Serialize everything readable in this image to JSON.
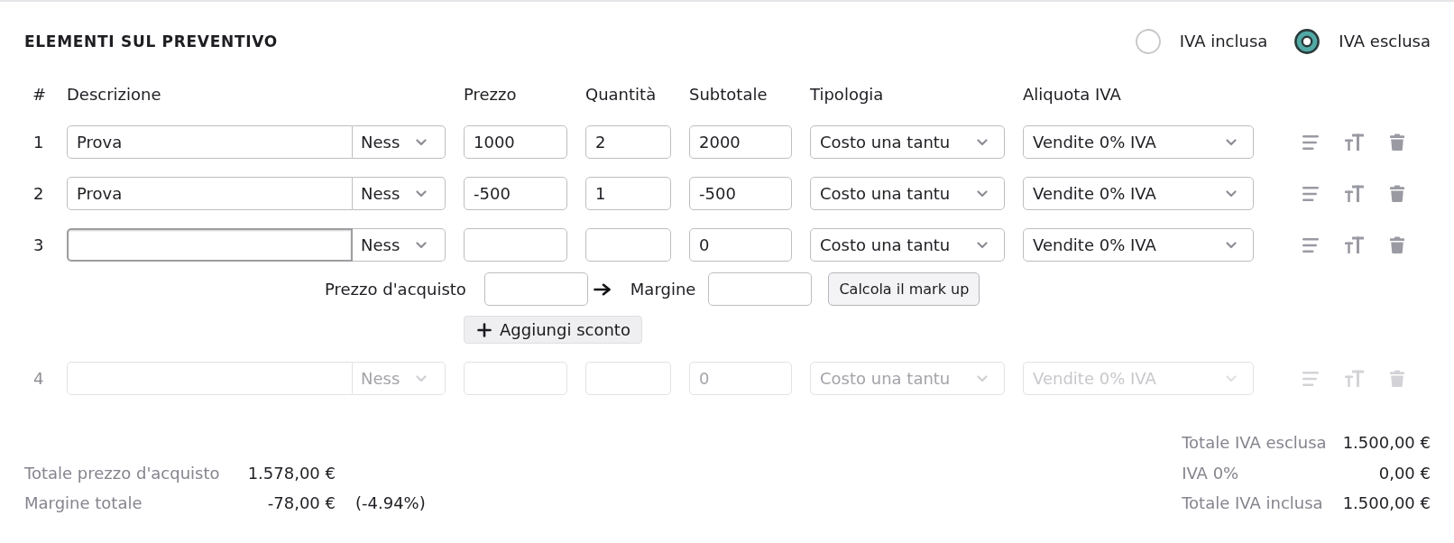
{
  "section": {
    "title": "ELEMENTI SUL PREVENTIVO"
  },
  "vat_mode": [
    {
      "label": "IVA inclusa",
      "selected": false
    },
    {
      "label": "IVA esclusa",
      "selected": true
    }
  ],
  "columns": [
    "#",
    "Descrizione",
    "Prezzo",
    "Quantità",
    "Subtotale",
    "Tipologia",
    "Aliquota IVA"
  ],
  "rows": [
    {
      "number": "1",
      "description": "Prova",
      "unit": "Ness",
      "price": "1000",
      "quantity": "2",
      "subtotal": "2000",
      "type": "Costo una tantu",
      "vat_rate": "Vendite 0% IVA",
      "focused": false,
      "disabled": false
    },
    {
      "number": "2",
      "description": "Prova",
      "unit": "Ness",
      "price": "-500",
      "quantity": "1",
      "subtotal": "-500",
      "type": "Costo una tantu",
      "vat_rate": "Vendite 0% IVA",
      "focused": false,
      "disabled": false
    },
    {
      "number": "3",
      "unit": "Ness",
      "subtotal": "0",
      "type": "Costo una tantu",
      "vat_rate": "Vendite 0% IVA",
      "focused": true,
      "disabled": false,
      "markup": {
        "purchase_price_label": "Prezzo d'acquisto",
        "margin_label": "Margine",
        "calculate_button": "Calcola il mark up"
      },
      "discount_button": "Aggiungi sconto"
    },
    {
      "number": "4",
      "unit": "Ness",
      "subtotal": "0",
      "type": "Costo una tantu",
      "vat_rate": "Vendite 0% IVA",
      "focused": false,
      "disabled": true
    }
  ],
  "purchase_summary": [
    {
      "label": "Totale prezzo d'acquisto",
      "value": "1.578,00 €"
    },
    {
      "label": "Margine totale",
      "value": "-78,00 €",
      "percentage": "(-4.94%)"
    }
  ],
  "vat_totals": [
    {
      "label": "Totale IVA esclusa",
      "value": "1.500,00 €"
    },
    {
      "label": "IVA 0%",
      "value": "0,00 €"
    },
    {
      "label": "Totale IVA inclusa",
      "value": "1.500,00 €"
    }
  ]
}
